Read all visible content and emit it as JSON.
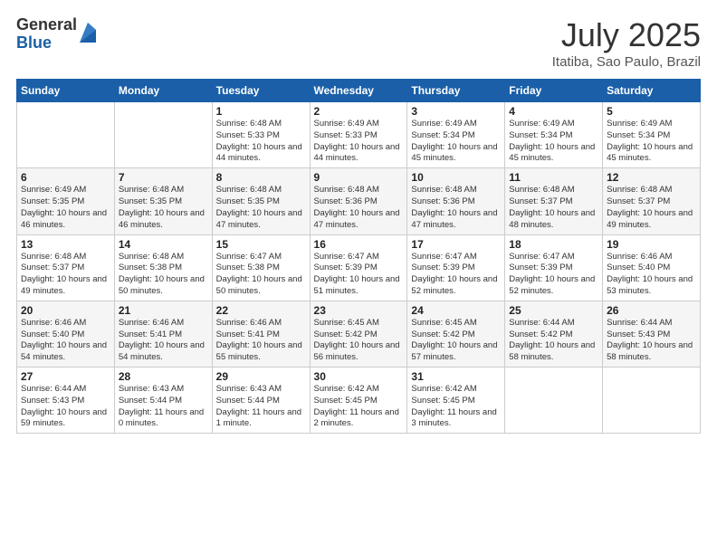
{
  "logo": {
    "general": "General",
    "blue": "Blue"
  },
  "header": {
    "month": "July 2025",
    "location": "Itatiba, Sao Paulo, Brazil"
  },
  "days_of_week": [
    "Sunday",
    "Monday",
    "Tuesday",
    "Wednesday",
    "Thursday",
    "Friday",
    "Saturday"
  ],
  "weeks": [
    [
      {
        "day": "",
        "info": ""
      },
      {
        "day": "",
        "info": ""
      },
      {
        "day": "1",
        "info": "Sunrise: 6:48 AM\nSunset: 5:33 PM\nDaylight: 10 hours and 44 minutes."
      },
      {
        "day": "2",
        "info": "Sunrise: 6:49 AM\nSunset: 5:33 PM\nDaylight: 10 hours and 44 minutes."
      },
      {
        "day": "3",
        "info": "Sunrise: 6:49 AM\nSunset: 5:34 PM\nDaylight: 10 hours and 45 minutes."
      },
      {
        "day": "4",
        "info": "Sunrise: 6:49 AM\nSunset: 5:34 PM\nDaylight: 10 hours and 45 minutes."
      },
      {
        "day": "5",
        "info": "Sunrise: 6:49 AM\nSunset: 5:34 PM\nDaylight: 10 hours and 45 minutes."
      }
    ],
    [
      {
        "day": "6",
        "info": "Sunrise: 6:49 AM\nSunset: 5:35 PM\nDaylight: 10 hours and 46 minutes."
      },
      {
        "day": "7",
        "info": "Sunrise: 6:48 AM\nSunset: 5:35 PM\nDaylight: 10 hours and 46 minutes."
      },
      {
        "day": "8",
        "info": "Sunrise: 6:48 AM\nSunset: 5:35 PM\nDaylight: 10 hours and 47 minutes."
      },
      {
        "day": "9",
        "info": "Sunrise: 6:48 AM\nSunset: 5:36 PM\nDaylight: 10 hours and 47 minutes."
      },
      {
        "day": "10",
        "info": "Sunrise: 6:48 AM\nSunset: 5:36 PM\nDaylight: 10 hours and 47 minutes."
      },
      {
        "day": "11",
        "info": "Sunrise: 6:48 AM\nSunset: 5:37 PM\nDaylight: 10 hours and 48 minutes."
      },
      {
        "day": "12",
        "info": "Sunrise: 6:48 AM\nSunset: 5:37 PM\nDaylight: 10 hours and 49 minutes."
      }
    ],
    [
      {
        "day": "13",
        "info": "Sunrise: 6:48 AM\nSunset: 5:37 PM\nDaylight: 10 hours and 49 minutes."
      },
      {
        "day": "14",
        "info": "Sunrise: 6:48 AM\nSunset: 5:38 PM\nDaylight: 10 hours and 50 minutes."
      },
      {
        "day": "15",
        "info": "Sunrise: 6:47 AM\nSunset: 5:38 PM\nDaylight: 10 hours and 50 minutes."
      },
      {
        "day": "16",
        "info": "Sunrise: 6:47 AM\nSunset: 5:39 PM\nDaylight: 10 hours and 51 minutes."
      },
      {
        "day": "17",
        "info": "Sunrise: 6:47 AM\nSunset: 5:39 PM\nDaylight: 10 hours and 52 minutes."
      },
      {
        "day": "18",
        "info": "Sunrise: 6:47 AM\nSunset: 5:39 PM\nDaylight: 10 hours and 52 minutes."
      },
      {
        "day": "19",
        "info": "Sunrise: 6:46 AM\nSunset: 5:40 PM\nDaylight: 10 hours and 53 minutes."
      }
    ],
    [
      {
        "day": "20",
        "info": "Sunrise: 6:46 AM\nSunset: 5:40 PM\nDaylight: 10 hours and 54 minutes."
      },
      {
        "day": "21",
        "info": "Sunrise: 6:46 AM\nSunset: 5:41 PM\nDaylight: 10 hours and 54 minutes."
      },
      {
        "day": "22",
        "info": "Sunrise: 6:46 AM\nSunset: 5:41 PM\nDaylight: 10 hours and 55 minutes."
      },
      {
        "day": "23",
        "info": "Sunrise: 6:45 AM\nSunset: 5:42 PM\nDaylight: 10 hours and 56 minutes."
      },
      {
        "day": "24",
        "info": "Sunrise: 6:45 AM\nSunset: 5:42 PM\nDaylight: 10 hours and 57 minutes."
      },
      {
        "day": "25",
        "info": "Sunrise: 6:44 AM\nSunset: 5:42 PM\nDaylight: 10 hours and 58 minutes."
      },
      {
        "day": "26",
        "info": "Sunrise: 6:44 AM\nSunset: 5:43 PM\nDaylight: 10 hours and 58 minutes."
      }
    ],
    [
      {
        "day": "27",
        "info": "Sunrise: 6:44 AM\nSunset: 5:43 PM\nDaylight: 10 hours and 59 minutes."
      },
      {
        "day": "28",
        "info": "Sunrise: 6:43 AM\nSunset: 5:44 PM\nDaylight: 11 hours and 0 minutes."
      },
      {
        "day": "29",
        "info": "Sunrise: 6:43 AM\nSunset: 5:44 PM\nDaylight: 11 hours and 1 minute."
      },
      {
        "day": "30",
        "info": "Sunrise: 6:42 AM\nSunset: 5:45 PM\nDaylight: 11 hours and 2 minutes."
      },
      {
        "day": "31",
        "info": "Sunrise: 6:42 AM\nSunset: 5:45 PM\nDaylight: 11 hours and 3 minutes."
      },
      {
        "day": "",
        "info": ""
      },
      {
        "day": "",
        "info": ""
      }
    ]
  ]
}
